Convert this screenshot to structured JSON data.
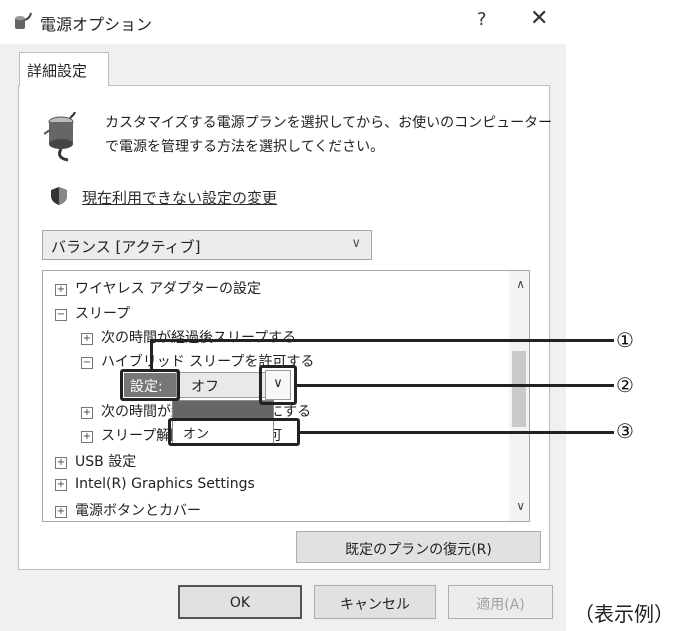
{
  "window": {
    "title": "電源オプション",
    "help_glyph": "?",
    "close_glyph": "✕"
  },
  "tab": {
    "label": "詳細設定"
  },
  "description": {
    "line1": "カスタマイズする電源プランを選択してから、お使いのコンピューター",
    "line2": "で電源を管理する方法を選択してください。"
  },
  "change_link": "現在利用できない設定の変更",
  "plan_select": {
    "value": "バランス [アクティブ]",
    "chevron": "∨"
  },
  "tree": {
    "items": [
      {
        "toggle": "+",
        "label": "ワイヤレス アダプターの設定"
      },
      {
        "toggle": "−",
        "label": "スリープ"
      },
      {
        "toggle": "+",
        "label": "次の時間が経過後スリープする"
      },
      {
        "toggle": "−",
        "label": "ハイブリッド スリープを許可する"
      },
      {
        "toggle": "+",
        "label": "次の時間が経過後休止状態にする"
      },
      {
        "toggle": "+",
        "label": "スリープ解除タイマーの許可"
      },
      {
        "toggle": "+",
        "label": "USB 設定"
      },
      {
        "toggle": "+",
        "label": "Intel(R) Graphics Settings"
      },
      {
        "toggle": "+",
        "label": "電源ボタンとカバー"
      }
    ],
    "setting_label": "設定:",
    "setting_value": "オフ",
    "dropdown_chevron": "∨",
    "dropdown_option": "オン",
    "scroll_up": "∧",
    "scroll_down": "∨"
  },
  "callouts": {
    "c1": "①",
    "c2": "②",
    "c3": "③"
  },
  "buttons": {
    "restore": "既定のプランの復元(R)",
    "ok": "OK",
    "cancel": "キャンセル",
    "apply": "適用(A)"
  },
  "caption": "（表示例）"
}
